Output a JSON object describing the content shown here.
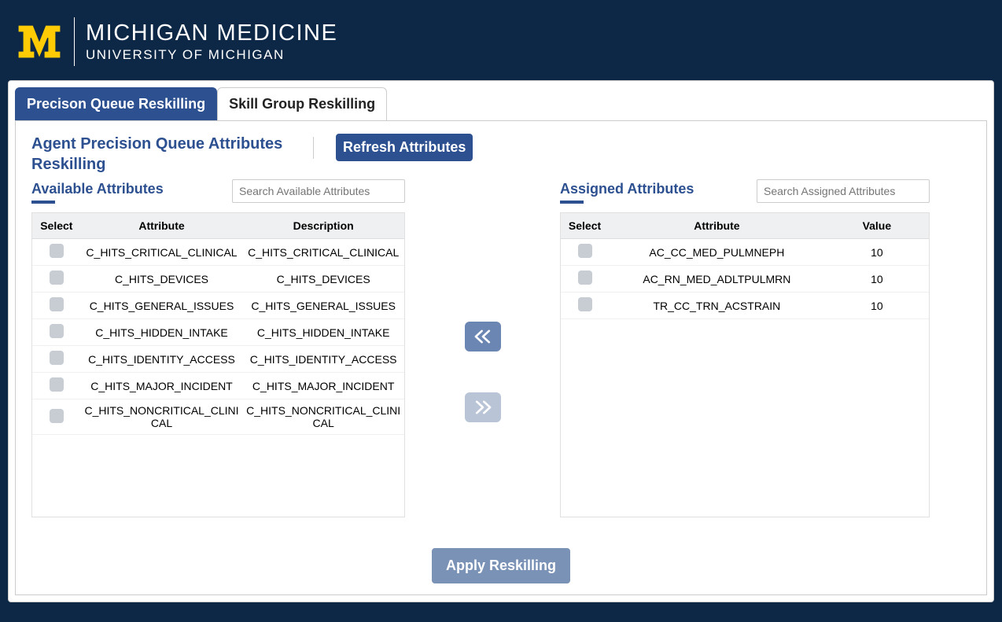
{
  "header": {
    "main": "MICHIGAN MEDICINE",
    "sub": "UNIVERSITY OF MICHIGAN"
  },
  "tabs": [
    {
      "label": "Precison Queue Reskilling",
      "active": true
    },
    {
      "label": "Skill Group Reskilling",
      "active": false
    }
  ],
  "pageTitle": "Agent Precision Queue Attributes Reskilling",
  "refreshLabel": "Refresh Attributes",
  "available": {
    "title": "Available Attributes",
    "searchPlaceholder": "Search Available Attributes",
    "cols": {
      "select": "Select",
      "attribute": "Attribute",
      "description": "Description"
    },
    "rows": [
      {
        "attribute": "C_HITS_CRITICAL_CLINICAL",
        "description": "C_HITS_CRITICAL_CLINICAL"
      },
      {
        "attribute": "C_HITS_DEVICES",
        "description": "C_HITS_DEVICES"
      },
      {
        "attribute": "C_HITS_GENERAL_ISSUES",
        "description": "C_HITS_GENERAL_ISSUES"
      },
      {
        "attribute": "C_HITS_HIDDEN_INTAKE",
        "description": "C_HITS_HIDDEN_INTAKE"
      },
      {
        "attribute": "C_HITS_IDENTITY_ACCESS",
        "description": "C_HITS_IDENTITY_ACCESS"
      },
      {
        "attribute": "C_HITS_MAJOR_INCIDENT",
        "description": "C_HITS_MAJOR_INCIDENT"
      },
      {
        "attribute": "C_HITS_NONCRITICAL_CLINICAL",
        "description": "C_HITS_NONCRITICAL_CLINICAL"
      }
    ]
  },
  "assigned": {
    "title": "Assigned Attributes",
    "searchPlaceholder": "Search Assigned Attributes",
    "cols": {
      "select": "Select",
      "attribute": "Attribute",
      "value": "Value"
    },
    "rows": [
      {
        "attribute": "AC_CC_MED_PULMNEPH",
        "value": "10"
      },
      {
        "attribute": "AC_RN_MED_ADLTPULMRN",
        "value": "10"
      },
      {
        "attribute": "TR_CC_TRN_ACSTRAIN",
        "value": "10"
      }
    ]
  },
  "applyLabel": "Apply Reskilling"
}
